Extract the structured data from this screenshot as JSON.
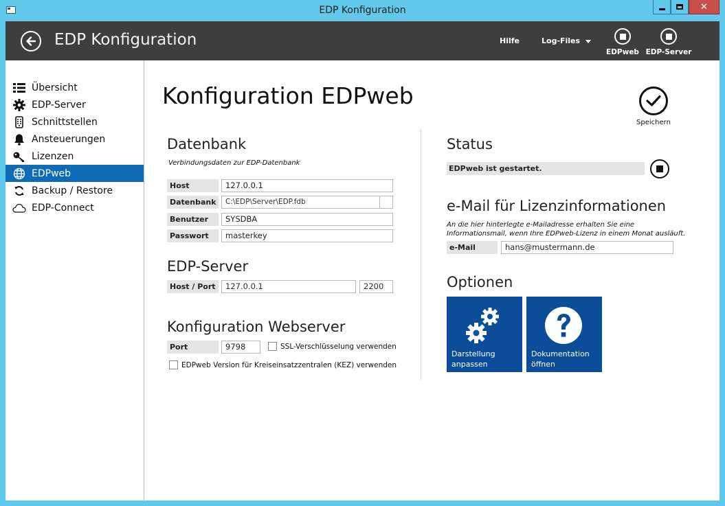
{
  "window": {
    "title": "EDP Konfiguration"
  },
  "header": {
    "title": "EDP Konfiguration",
    "hilfe": "Hilfe",
    "logfiles": "Log-Files",
    "edpweb_btn": "EDPweb",
    "edpserver_btn": "EDP-Server"
  },
  "sidebar": {
    "items": [
      {
        "label": "Übersicht",
        "icon": "list-icon"
      },
      {
        "label": "EDP-Server",
        "icon": "gear-icon"
      },
      {
        "label": "Schnittstellen",
        "icon": "remote-icon"
      },
      {
        "label": "Ansteuerungen",
        "icon": "bell-icon"
      },
      {
        "label": "Lizenzen",
        "icon": "key-icon"
      },
      {
        "label": "EDPweb",
        "icon": "globe-icon",
        "active": true
      },
      {
        "label": "Backup / Restore",
        "icon": "sync-icon"
      },
      {
        "label": "EDP-Connect",
        "icon": "cloud-icon"
      }
    ]
  },
  "main": {
    "title": "Konfiguration EDPweb",
    "save_label": "Speichern",
    "datenbank": {
      "heading": "Datenbank",
      "hint": "Verbindungsdaten zur EDP-Datenbank",
      "host_label": "Host",
      "host_value": "127.0.0.1",
      "datenbank_label": "Datenbank",
      "datenbank_value": "C:\\EDP\\Server\\EDP.fdb",
      "benutzer_label": "Benutzer",
      "benutzer_value": "SYSDBA",
      "passwort_label": "Passwort",
      "passwort_value": "masterkey"
    },
    "edpserver": {
      "heading": "EDP-Server",
      "hostport_label": "Host / Port",
      "host_value": "127.0.0.1",
      "port_value": "2200"
    },
    "webserver": {
      "heading": "Konfiguration Webserver",
      "port_label": "Port",
      "port_value": "9798",
      "ssl_label": "SSL-Verschlüsselung verwenden",
      "kez_label": "EDPweb Version für Kreiseinsatzzentralen (KEZ) verwenden"
    },
    "status": {
      "heading": "Status",
      "text": "EDPweb ist gestartet."
    },
    "email": {
      "heading": "e-Mail für Lizenzinformationen",
      "hint_line1": "An die hier hinterlegte e-Mailadresse erhalten Sie eine",
      "hint_line2": "Informationsmail, wenn Ihre EDPweb-Lizenz in einem Monat ausläuft.",
      "label": "e-Mail",
      "value": "hans@mustermann.de"
    },
    "optionen": {
      "heading": "Optionen",
      "tile1_line1": "Darstellung",
      "tile1_line2": "anpassen",
      "tile2_line1": "Dokumentation",
      "tile2_line2": "öffnen"
    }
  },
  "colors": {
    "titlebar": "#62c9ec",
    "header": "#3e3e3e",
    "accent": "#0e6cb7",
    "tile": "#0c4d9a"
  }
}
